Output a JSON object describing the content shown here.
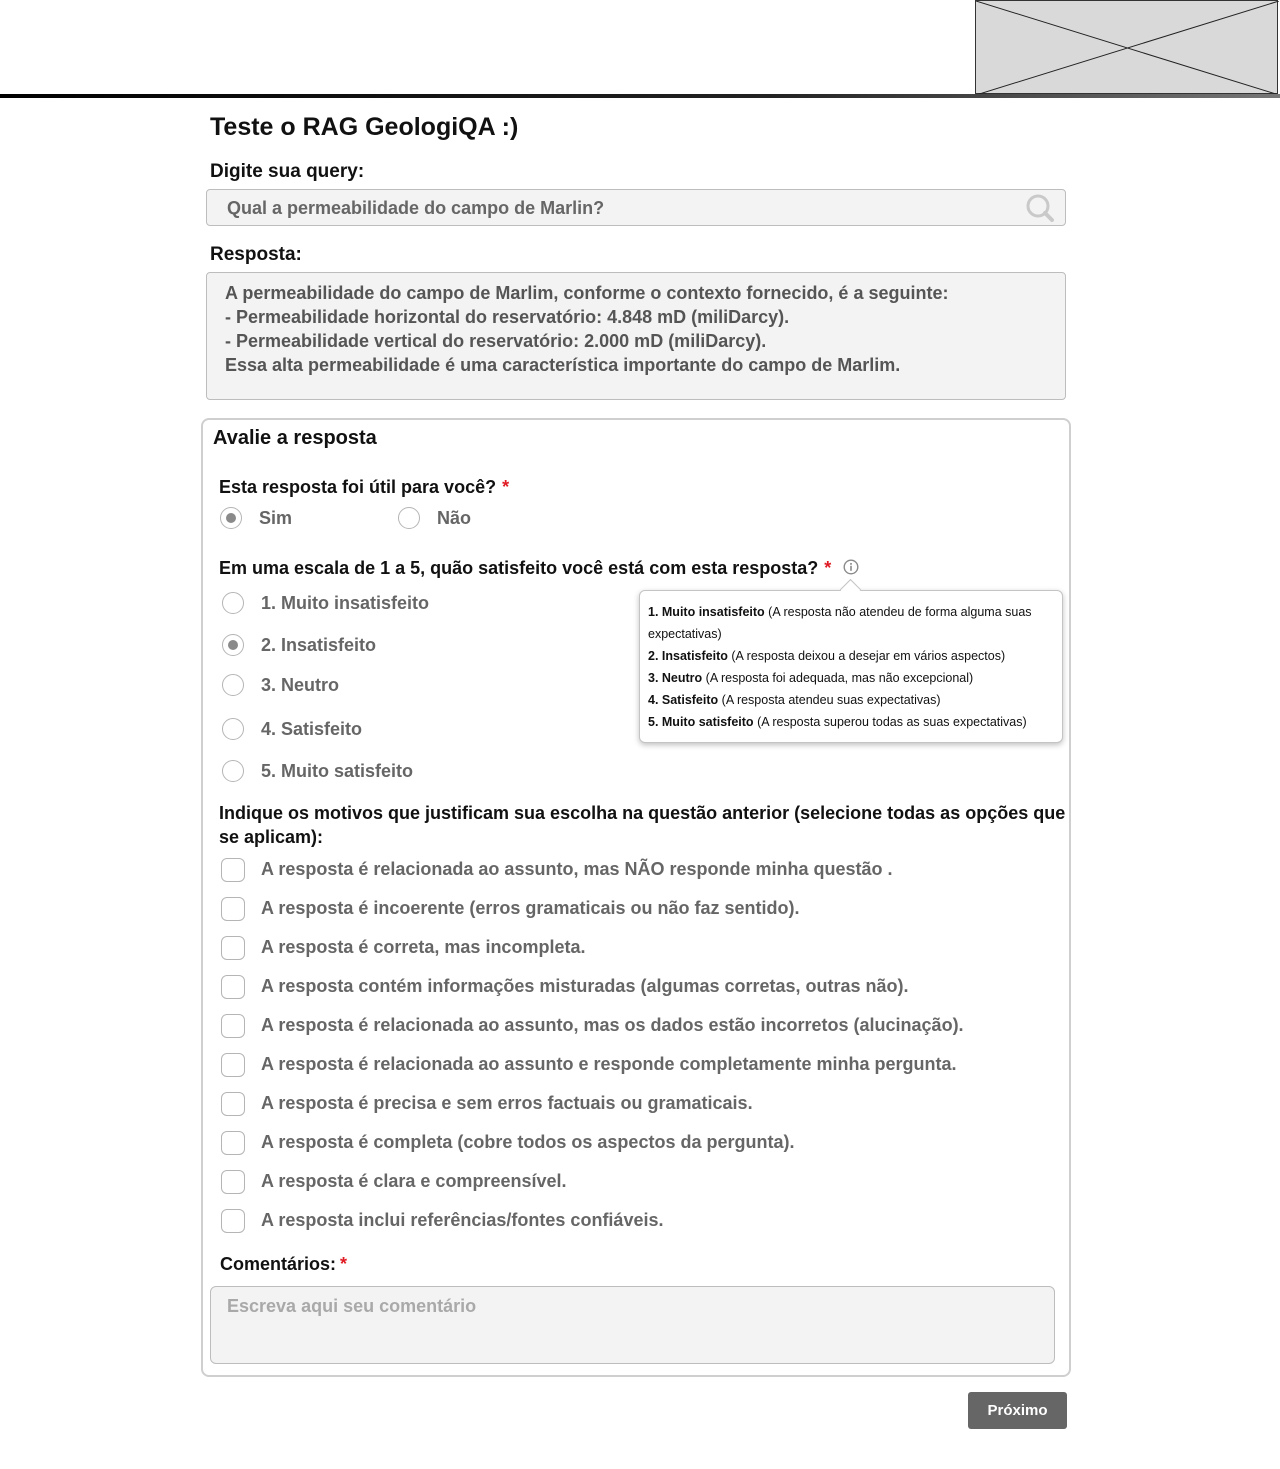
{
  "header": {
    "logo_placeholder": "logo-placeholder"
  },
  "page": {
    "title": "Teste o RAG GeologiQA :)"
  },
  "query": {
    "label": "Digite sua query:",
    "value": "Qual a permeabilidade do campo de Marlin?",
    "icon": "search-icon"
  },
  "answer": {
    "label": "Resposta:",
    "lines": [
      "A permeabilidade do campo de Marlim, conforme o contexto fornecido, é a seguinte:",
      "- Permeabilidade horizontal do reservatório: 4.848 mD (miliDarcy).",
      "- Permeabilidade vertical do reservatório: 2.000 mD (miliDarcy).",
      "Essa alta permeabilidade é uma característica importante do campo de Marlim."
    ]
  },
  "evaluation": {
    "title": "Avalie a resposta",
    "required_mark": "*",
    "useful": {
      "question": "Esta resposta foi útil para você?",
      "options": [
        {
          "label": "Sim",
          "selected": true
        },
        {
          "label": "Não",
          "selected": false
        }
      ]
    },
    "scale": {
      "question": "Em uma escala de 1 a 5, quão satisfeito você está com esta resposta?",
      "info_icon": "info-icon",
      "options": [
        {
          "label": "1. Muito insatisfeito",
          "selected": false
        },
        {
          "label": "2. Insatisfeito",
          "selected": true
        },
        {
          "label": "3. Neutro",
          "selected": false
        },
        {
          "label": "4. Satisfeito",
          "selected": false
        },
        {
          "label": "5. Muito satisfeito",
          "selected": false
        }
      ],
      "tooltip": [
        {
          "term": "1. Muito insatisfeito",
          "desc": "(A resposta não atendeu de forma alguma suas expectativas)"
        },
        {
          "term": "2. Insatisfeito",
          "desc": "(A resposta deixou a desejar em vários aspectos)"
        },
        {
          "term": "3. Neutro",
          "desc": "(A resposta foi adequada, mas não excepcional)"
        },
        {
          "term": "4. Satisfeito",
          "desc": "(A resposta atendeu suas expectativas)"
        },
        {
          "term": "5. Muito satisfeito",
          "desc": "(A resposta superou todas as suas expectativas)"
        }
      ]
    },
    "reasons": {
      "question_line1": "Indique os motivos que justificam sua escolha na questão anterior (selecione todas as opções que",
      "question_line2": "se aplicam):",
      "options": [
        "A resposta é relacionada ao assunto, mas NÃO responde minha questão .",
        "A resposta é incoerente (erros gramaticais ou não faz sentido).",
        "A resposta é correta, mas incompleta.",
        "A resposta contém informações misturadas (algumas corretas, outras não).",
        "A resposta é relacionada ao assunto, mas os dados estão incorretos (alucinação).",
        "A resposta é relacionada ao assunto e responde completamente minha pergunta.",
        "A resposta é precisa e sem erros factuais ou gramaticais.",
        "A resposta é completa (cobre todos os aspectos da pergunta).",
        "A resposta é clara e compreensível.",
        "A resposta inclui referências/fontes confiáveis."
      ]
    },
    "comments": {
      "label": "Comentários:",
      "placeholder": "Escreva aqui seu comentário",
      "value": ""
    }
  },
  "actions": {
    "next_label": "Próximo"
  }
}
